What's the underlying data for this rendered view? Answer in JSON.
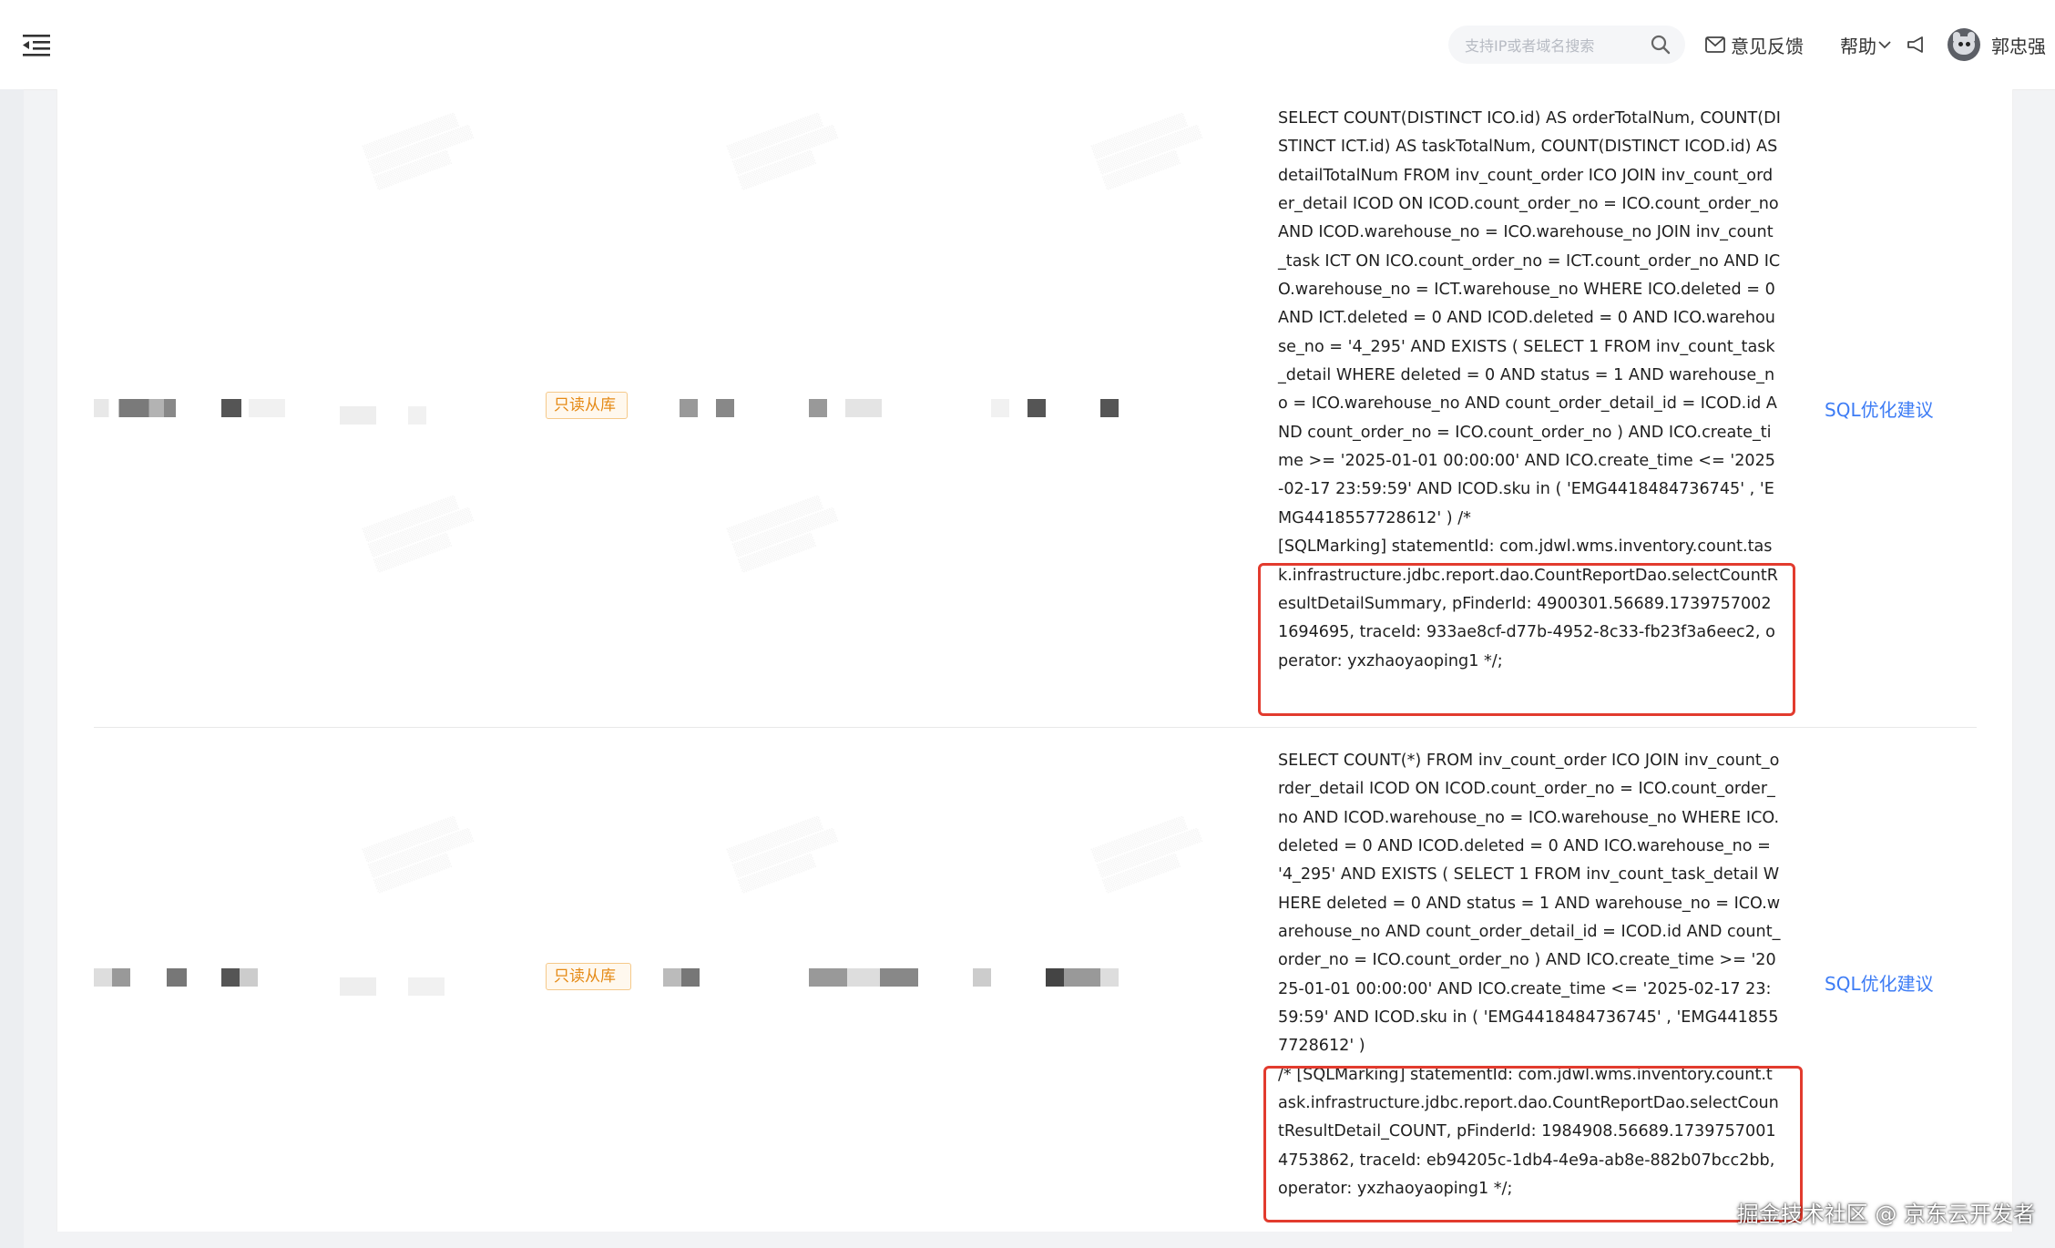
{
  "header": {
    "search": {
      "placeholder": "支持IP或者域名搜索"
    },
    "feedback_label": "意见反馈",
    "help_label": "帮助",
    "user_name": "郭忠强"
  },
  "rows": [
    {
      "tag": "只读从库",
      "sql": "SELECT COUNT(DISTINCT ICO.id) AS orderTotalNum, COUNT(DISTINCT ICT.id) AS taskTotalNum, COUNT(DISTINCT ICOD.id) AS detailTotalNum FROM inv_count_order ICO JOIN inv_count_order_detail ICOD ON ICOD.count_order_no = ICO.count_order_no AND ICOD.warehouse_no = ICO.warehouse_no JOIN inv_count_task ICT ON ICO.count_order_no = ICT.count_order_no AND ICO.warehouse_no = ICT.warehouse_no WHERE ICO.deleted = 0 AND ICT.deleted = 0 AND ICOD.deleted = 0 AND ICO.warehouse_no = '4_295' AND EXISTS ( SELECT 1 FROM inv_count_task_detail WHERE deleted = 0 AND status = 1 AND warehouse_no = ICO.warehouse_no AND count_order_detail_id = ICOD.id AND count_order_no = ICO.count_order_no ) AND ICO.create_time >= '2025-01-01 00:00:00' AND ICO.create_time <= '2025-02-17 23:59:59' AND ICOD.sku in ( 'EMG4418484736745' , 'EMG4418557728612' ) /*",
      "sql_marking": "[SQLMarking] statementId: com.jdwl.wms.inventory.count.task.infrastructure.jdbc.report.dao.CountReportDao.selectCountResultDetailSummary, pFinderId: 4900301.56689.17397570021694695, traceId: 933ae8cf-d77b-4952-8c33-fb23f3a6eec2, operator: yxzhaoyaoping1 */;",
      "advice_label": "SQL优化建议"
    },
    {
      "tag": "只读从库",
      "sql": "SELECT COUNT(*) FROM inv_count_order ICO JOIN inv_count_order_detail ICOD ON ICOD.count_order_no = ICO.count_order_no AND ICOD.warehouse_no = ICO.warehouse_no WHERE ICO.deleted = 0 AND ICOD.deleted = 0 AND ICO.warehouse_no = '4_295' AND EXISTS ( SELECT 1 FROM inv_count_task_detail WHERE deleted = 0 AND status = 1 AND warehouse_no = ICO.warehouse_no AND count_order_detail_id = ICOD.id AND count_order_no = ICO.count_order_no ) AND ICO.create_time >= '2025-01-01 00:00:00' AND ICO.create_time <= '2025-02-17 23:59:59' AND ICOD.sku in ( 'EMG4418484736745' , 'EMG4418557728612' )",
      "sql_marking": "/* [SQLMarking] statementId: com.jdwl.wms.inventory.count.task.infrastructure.jdbc.report.dao.CountReportDao.selectCountResultDetail_COUNT, pFinderId: 1984908.56689.17397570014753862, traceId: eb94205c-1db4-4e9a-ab8e-882b07bcc2bb, operator: yxzhaoyaoping1 */;",
      "advice_label": "SQL优化建议"
    }
  ],
  "footer_brand": "掘金技术社区 @ 京东云开发者",
  "colors": {
    "link": "#3d7cf5",
    "highlight": "#e23b2e",
    "tag_text": "#e58a16",
    "tag_border": "#f5c98a"
  },
  "icons": [
    "menu-fold-icon",
    "search-icon",
    "mail-icon",
    "chevron-down-icon",
    "announcement-icon",
    "cat-avatar"
  ]
}
